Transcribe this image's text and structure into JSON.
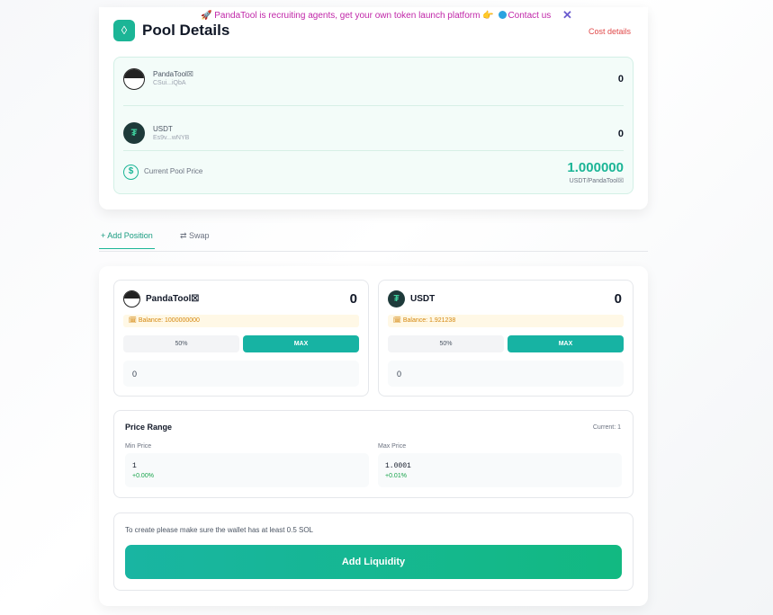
{
  "banner": {
    "text": "🚀 PandaTool is recruiting agents, get your own token launch platform 👉",
    "contact": "Contact us",
    "close_icon": "✕"
  },
  "pool": {
    "title": "Pool Details",
    "cost_details": "Cost details",
    "token_a": {
      "name": "PandaTool☒",
      "address": "CSui...iQbA",
      "amount": "0"
    },
    "token_b": {
      "name": "USDT",
      "address": "Es9v...wNYB",
      "amount": "0"
    },
    "price_label": "Current Pool Price",
    "price_value": "1.000000",
    "price_unit": "USDT/PandaTool☒"
  },
  "tabs": {
    "add_position": "+ Add Position",
    "swap": "⇄ Swap"
  },
  "position": {
    "token_a": {
      "name": "PandaTool☒",
      "amount": "0",
      "balance": "🗓 Balance: 1000000000",
      "half": "50%",
      "max": "MAX",
      "input": "0"
    },
    "token_b": {
      "name": "USDT",
      "amount": "0",
      "balance": "🗓 Balance: 1.921238",
      "half": "50%",
      "max": "MAX",
      "input": "0"
    }
  },
  "price_range": {
    "title": "Price Range",
    "current": "Current: 1",
    "min_label": "Min Price",
    "min_value": "1",
    "min_pct": "+0.00%",
    "max_label": "Max Price",
    "max_value": "1.0001",
    "max_pct": "+0.01%"
  },
  "create": {
    "note": "To create please make sure the wallet has at least 0.5 SOL",
    "button": "Add Liquidity"
  },
  "colors": {
    "accent": "#1bb596",
    "warning": "#d4860b",
    "danger": "#e04848"
  }
}
